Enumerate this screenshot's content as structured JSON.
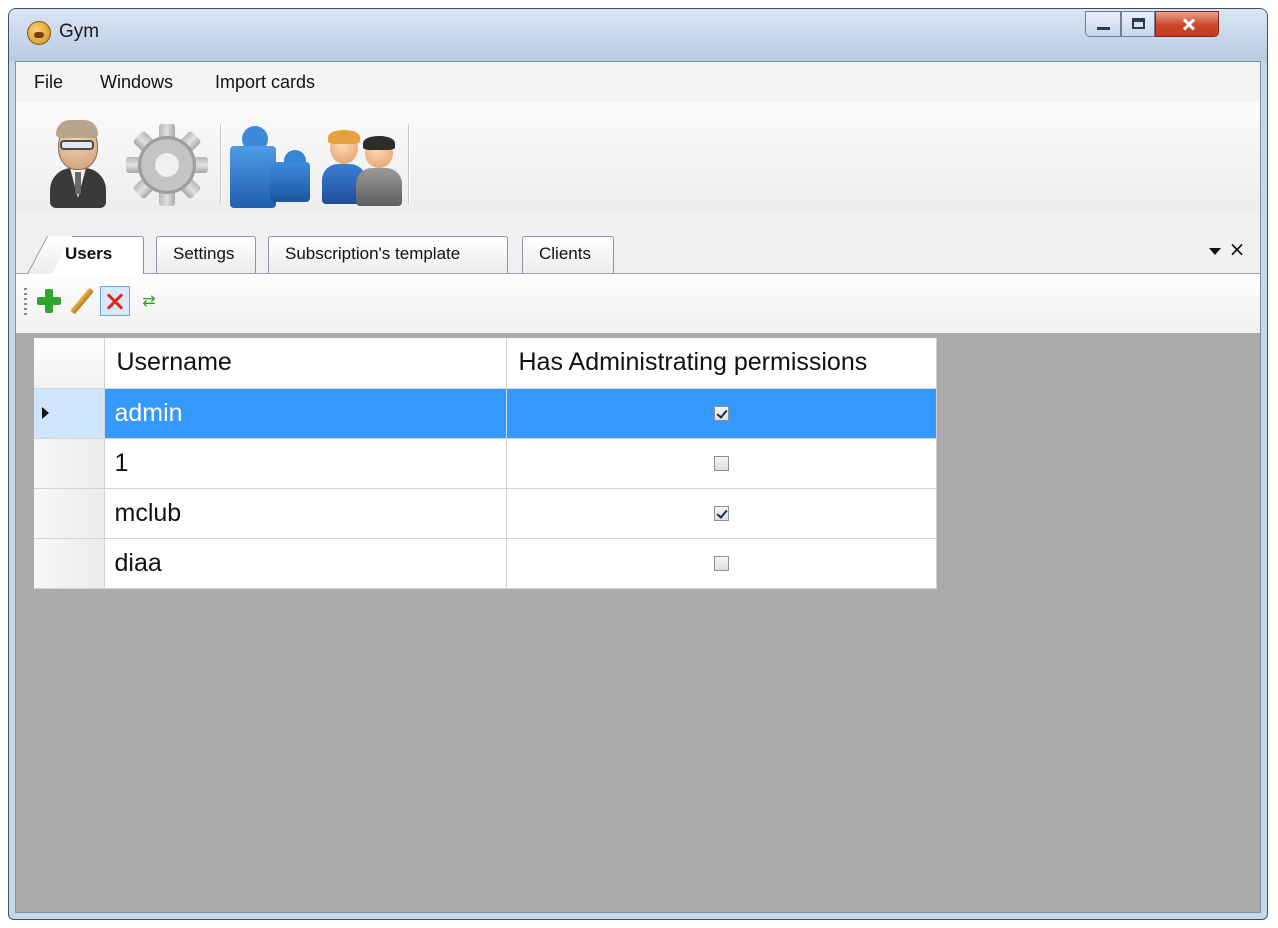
{
  "window": {
    "title": "Gym",
    "app_icon": "gym-app-icon"
  },
  "menu": {
    "items": [
      "File",
      "Windows",
      "Import cards"
    ]
  },
  "toolbar": {
    "icons": [
      "user-icon",
      "gear-icon",
      "puzzle-icon",
      "clients-icon"
    ]
  },
  "tabs": [
    "Users",
    "Settings",
    "Subscription's template",
    "Clients"
  ],
  "tab_controls": {
    "close": "×"
  },
  "grid_toolbar": {
    "icons": [
      "add-icon",
      "edit-icon",
      "delete-icon",
      "refresh-icon"
    ],
    "refresh_glyph": "⇄"
  },
  "grid": {
    "columns": [
      "Username",
      "Has Administrating permissions"
    ],
    "rows": [
      {
        "username": "admin",
        "is_admin": true,
        "selected": true
      },
      {
        "username": "1",
        "is_admin": false
      },
      {
        "username": "mclub",
        "is_admin": true
      },
      {
        "username": "diaa",
        "is_admin": false
      }
    ]
  },
  "colors": {
    "selection": "#3399ff",
    "grid_background": "#ababab",
    "add": "#2ea52e",
    "delete": "#e0261d"
  }
}
